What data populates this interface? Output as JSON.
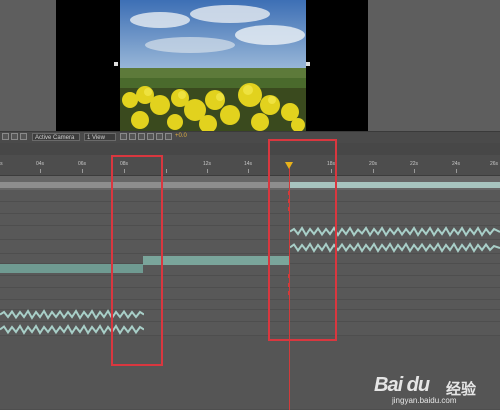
{
  "toolbar": {
    "zoom": "",
    "camera": "Active Camera",
    "view": "1 View",
    "exposure": "+0.0"
  },
  "ruler": {
    "labels": [
      "0s",
      "04s",
      "06s",
      "08s",
      "",
      "12s",
      "14s",
      "",
      "18s",
      "20s",
      "22s",
      "24s",
      "26s"
    ]
  },
  "colors": {
    "red_annotation": "#d9373f",
    "playhead": "#e8b11a",
    "layer_bar": "#79a49a",
    "audio_wave": "#a8cfc8"
  },
  "watermark": {
    "brand": "Bai du",
    "tail": "经验",
    "url": "jingyan.baidu.com"
  }
}
